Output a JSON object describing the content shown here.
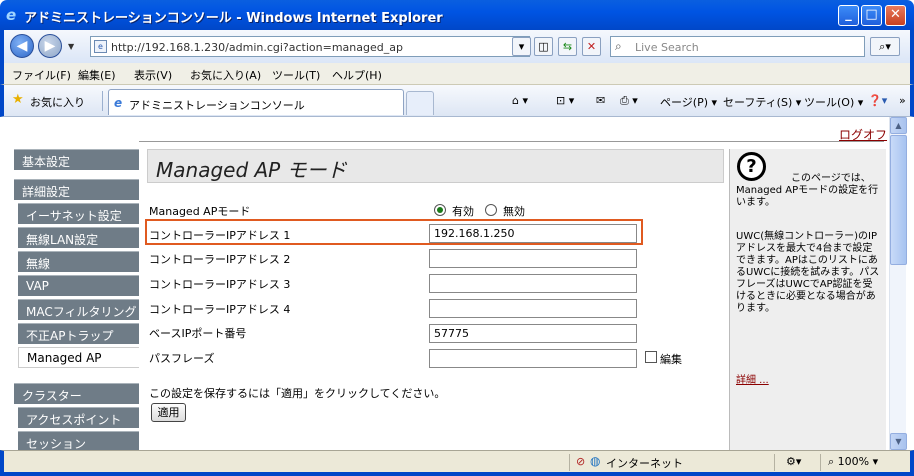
{
  "window": {
    "title": "アドミニストレーションコンソール - Windows Internet Explorer",
    "minimize": "_",
    "maximize": "□",
    "close": "✕"
  },
  "addressbar": {
    "url": "http://192.168.1.230/admin.cgi?action=managed_ap",
    "search_placeholder": "Live Search"
  },
  "menubar": [
    "ファイル(F)",
    "編集(E)",
    "表示(V)",
    "お気に入り(A)",
    "ツール(T)",
    "ヘルプ(H)"
  ],
  "favorites": {
    "label": "お気に入り",
    "tab_title": "アドミニストレーションコンソール",
    "page_menu": "ページ(P)",
    "safety_menu": "セーフティ(S)",
    "tools_menu": "ツール(O)"
  },
  "page": {
    "logout": "ログオフ",
    "heading": "Managed AP モード",
    "nav": {
      "basic": "基本設定",
      "advanced": "詳細設定",
      "ethernet": "イーサネット設定",
      "wlan": "無線LAN設定",
      "wireless": "無線",
      "vap": "VAP",
      "mac_filter": "MACフィルタリング",
      "rogue_ap": "不正APトラップ",
      "managed_ap": "Managed AP",
      "cluster": "クラスター",
      "access_point": "アクセスポイント",
      "session": "セッション"
    },
    "form": {
      "mode_label": "Managed APモード",
      "enabled_label": "有効",
      "disabled_label": "無効",
      "controller1_label": "コントローラーIPアドレス 1",
      "controller1_value": "192.168.1.250",
      "controller2_label": "コントローラーIPアドレス 2",
      "controller2_value": "",
      "controller3_label": "コントローラーIPアドレス 3",
      "controller3_value": "",
      "controller4_label": "コントローラーIPアドレス 4",
      "controller4_value": "",
      "base_port_label": "ベースIPポート番号",
      "base_port_value": "57775",
      "passphrase_label": "パスフレーズ",
      "passphrase_value": "",
      "edit_label": "編集",
      "save_note": "この設定を保存するには「適用」をクリックしてください。",
      "apply_label": "適用"
    },
    "help": {
      "icon": "?",
      "intro": "このページでは、Managed APモードの設定を行います。",
      "body": "UWC(無線コントローラー)のIPアドレスを最大で4台まで設定できます。APはこのリストにあるUWCに接続を試みます。パスフレーズはUWCでAP認証を受けるときに必要となる場合があります。",
      "more": "詳細 ..."
    }
  },
  "statusbar": {
    "zone": "インターネット",
    "zoom": "100%"
  }
}
